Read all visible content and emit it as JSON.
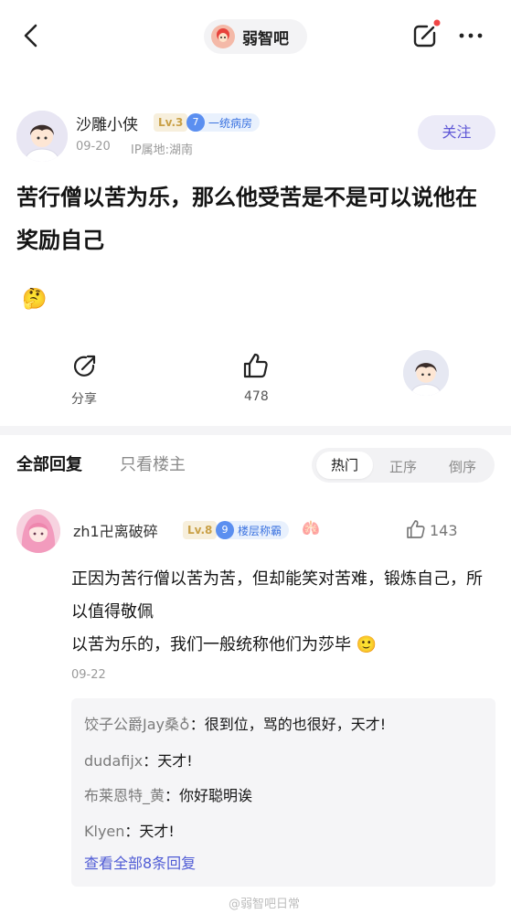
{
  "topbar": {
    "forum_name": "弱智吧"
  },
  "post": {
    "author": "沙雕小侠",
    "level": "Lv.3",
    "tag_level": "7",
    "tag_text": "一统病房",
    "date": "09-20",
    "ip": "IP属地:湖南",
    "follow_label": "关注",
    "title": "苦行僧以苦为乐，那么他受苦是不是可以说他在奖励自己",
    "emoji": "🤔"
  },
  "actions": {
    "share_label": "分享",
    "like_count": "478"
  },
  "tabs": {
    "all": "全部回复",
    "owner_only": "只看楼主",
    "sort_hot": "热门",
    "sort_asc": "正序",
    "sort_desc": "倒序"
  },
  "comment": {
    "author": "zh1卍离破碎",
    "level": "Lv.8",
    "tag_level": "9",
    "tag_text": "楼层称霸",
    "lung_emoji": "🫁",
    "like_count": "143",
    "text": "正因为苦行僧以苦为苦，但却能笑对苦难，锻炼自己，所以值得敬佩\n以苦为乐的，我们一般统称他们为莎毕 🙂",
    "date": "09-22",
    "replies": [
      {
        "name": "饺子公爵Jay桑♁",
        "text": "很到位，骂的也很好，天才!"
      },
      {
        "name": "dudafijx",
        "text": "天才!"
      },
      {
        "name": "布莱恩特_黄",
        "text": "你好聪明诶"
      },
      {
        "name": "Klyen",
        "text": "天才!"
      }
    ],
    "view_all": "查看全部8条回复"
  },
  "watermark": "@弱智吧日常",
  "colors": {
    "accent": "#5e57d6",
    "link": "#4f5bd5",
    "level_gold": "#c9a046",
    "tag_blue": "#3a72e0"
  }
}
